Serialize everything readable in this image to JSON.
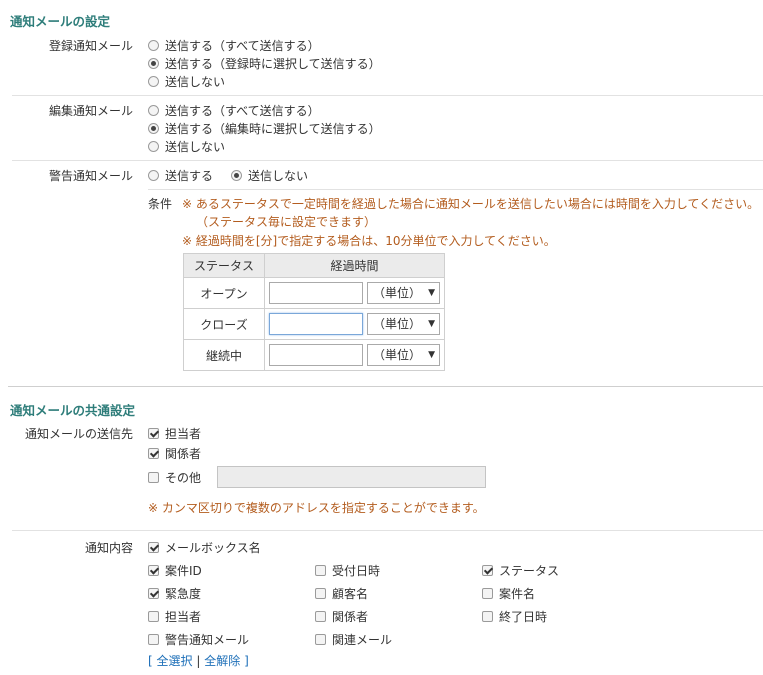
{
  "notify": {
    "title": "通知メールの設定",
    "register": {
      "label": "登録通知メール",
      "options": [
        "送信する（すべて送信する）",
        "送信する（登録時に選択して送信する）",
        "送信しない"
      ],
      "selected": 1
    },
    "edit": {
      "label": "編集通知メール",
      "options": [
        "送信する（すべて送信する）",
        "送信する（編集時に選択して送信する）",
        "送信しない"
      ],
      "selected": 1
    },
    "warning": {
      "label": "警告通知メール",
      "options": [
        "送信する",
        "送信しない"
      ],
      "selected": 1,
      "condition_label": "条件",
      "note1": "※ あるステータスで一定時間を経過した場合に通知メールを送信したい場合には時間を入力してください。",
      "note1b": "（ステータス毎に設定できます）",
      "note2": "※ 経過時間を[分]で指定する場合は、10分単位で入力してください。",
      "table": {
        "col_status": "ステータス",
        "col_elapsed": "経過時間",
        "rows": [
          {
            "status": "オープン",
            "value": "",
            "unit": "（単位）"
          },
          {
            "status": "クローズ",
            "value": "",
            "unit": "（単位）"
          },
          {
            "status": "継続中",
            "value": "",
            "unit": "（単位）"
          }
        ]
      }
    }
  },
  "common": {
    "title": "通知メールの共通設定",
    "recipients": {
      "label": "通知メールの送信先",
      "items": [
        {
          "label": "担当者",
          "checked": true
        },
        {
          "label": "関係者",
          "checked": true
        },
        {
          "label": "その他",
          "checked": false
        }
      ],
      "other_value": "",
      "note": "※ カンマ区切りで複数のアドレスを指定することができます。"
    },
    "content": {
      "label": "通知内容",
      "mailbox": {
        "label": "メールボックス名",
        "checked": true
      },
      "items": [
        {
          "label": "案件ID",
          "checked": true
        },
        {
          "label": "受付日時",
          "checked": false
        },
        {
          "label": "ステータス",
          "checked": true
        },
        {
          "label": "緊急度",
          "checked": true
        },
        {
          "label": "顧客名",
          "checked": false
        },
        {
          "label": "案件名",
          "checked": false
        },
        {
          "label": "担当者",
          "checked": false
        },
        {
          "label": "関係者",
          "checked": false
        },
        {
          "label": "終了日時",
          "checked": false
        },
        {
          "label": "警告通知メール",
          "checked": false
        },
        {
          "label": "関連メール",
          "checked": false
        }
      ],
      "select_all": "全選択",
      "deselect_all": "全解除",
      "bracket_open": "[",
      "bracket_sep": "|",
      "bracket_close": "]"
    }
  }
}
